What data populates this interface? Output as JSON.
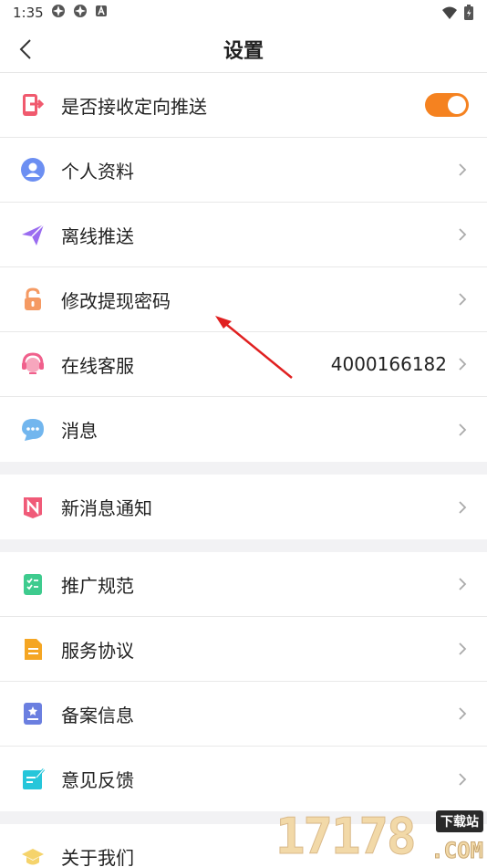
{
  "status_bar": {
    "time": "1:35"
  },
  "header": {
    "title": "设置"
  },
  "push_toggle": {
    "label": "是否接收定向推送",
    "on": true
  },
  "group1": [
    {
      "label": "个人资料"
    },
    {
      "label": "离线推送"
    },
    {
      "label": "修改提现密码"
    },
    {
      "label": "在线客服",
      "value": "4000166182"
    },
    {
      "label": "消息"
    }
  ],
  "group2": [
    {
      "label": "新消息通知"
    }
  ],
  "group3": [
    {
      "label": "推广规范"
    },
    {
      "label": "服务协议"
    },
    {
      "label": "备案信息"
    },
    {
      "label": "意见反馈"
    }
  ],
  "group4": [
    {
      "label": "关于我们"
    }
  ],
  "watermark": {
    "number": "17178",
    "badge": "下载站",
    "suffix": ".COM"
  },
  "colors": {
    "accent": "#f58220",
    "annotation_arrow": "#e02020"
  }
}
